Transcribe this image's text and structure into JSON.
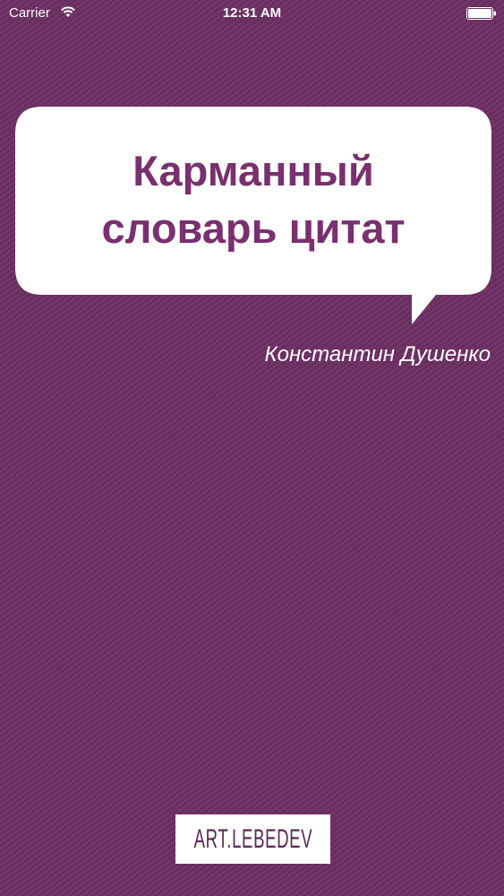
{
  "status_bar": {
    "carrier": "Carrier",
    "time": "12:31 AM",
    "wifi_icon": "wifi-icon",
    "battery_icon": "battery-icon"
  },
  "cover": {
    "title": "Карманный\nсловарь цитат",
    "author": "Константин Душенко",
    "publisher_logo": "ART.LEBEDEV"
  },
  "colors": {
    "background": "#6e2f64",
    "title_text": "#7a2f6f",
    "bubble": "#ffffff",
    "author_text": "#ffffff"
  }
}
